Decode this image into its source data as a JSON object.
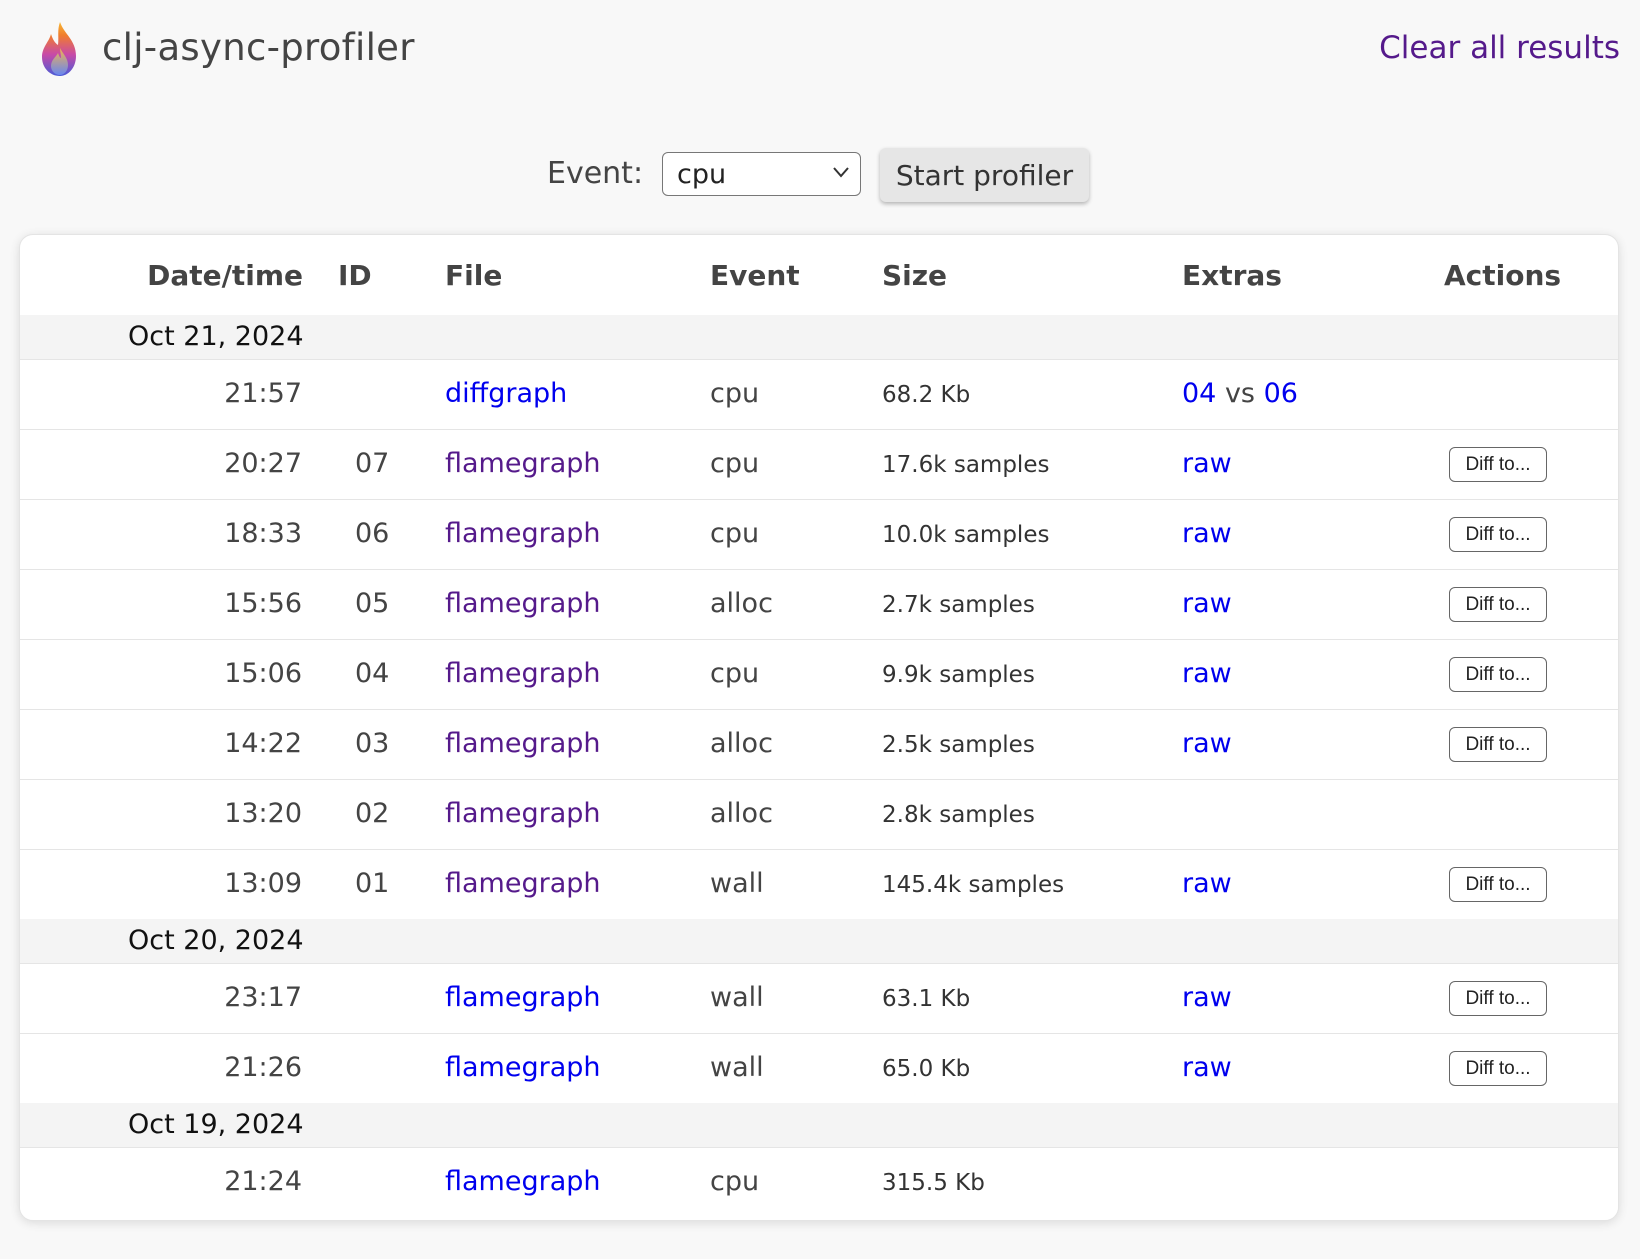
{
  "header": {
    "title": "clj-async-profiler",
    "clear_link": "Clear all results"
  },
  "controls": {
    "event_label": "Event:",
    "event_selected": "cpu",
    "start_button": "Start profiler"
  },
  "table": {
    "columns": [
      "Date/time",
      "ID",
      "File",
      "Event",
      "Size",
      "Extras",
      "Actions"
    ],
    "groups": [
      {
        "date": "Oct 21, 2024",
        "rows": [
          {
            "time": "21:57",
            "id": "",
            "file": "diffgraph",
            "event": "cpu",
            "size": "68.2 Kb",
            "extras_a": "04",
            "extras_vs": "vs",
            "extras_b": "06",
            "action": ""
          },
          {
            "time": "20:27",
            "id": "07",
            "file": "flamegraph",
            "event": "cpu",
            "size": "17.6k samples",
            "extras": "raw",
            "action": "Diff to..."
          },
          {
            "time": "18:33",
            "id": "06",
            "file": "flamegraph",
            "event": "cpu",
            "size": "10.0k samples",
            "extras": "raw",
            "action": "Diff to..."
          },
          {
            "time": "15:56",
            "id": "05",
            "file": "flamegraph",
            "event": "alloc",
            "size": "2.7k samples",
            "extras": "raw",
            "action": "Diff to..."
          },
          {
            "time": "15:06",
            "id": "04",
            "file": "flamegraph",
            "event": "cpu",
            "size": "9.9k samples",
            "extras": "raw",
            "action": "Diff to..."
          },
          {
            "time": "14:22",
            "id": "03",
            "file": "flamegraph",
            "event": "alloc",
            "size": "2.5k samples",
            "extras": "raw",
            "action": "Diff to..."
          },
          {
            "time": "13:20",
            "id": "02",
            "file": "flamegraph",
            "event": "alloc",
            "size": "2.8k samples",
            "extras": "",
            "action": ""
          },
          {
            "time": "13:09",
            "id": "01",
            "file": "flamegraph",
            "event": "wall",
            "size": "145.4k samples",
            "extras": "raw",
            "action": "Diff to..."
          }
        ]
      },
      {
        "date": "Oct 20, 2024",
        "rows": [
          {
            "time": "23:17",
            "id": "",
            "file": "flamegraph",
            "event": "wall",
            "size": "63.1 Kb",
            "extras": "raw",
            "action": "Diff to..."
          },
          {
            "time": "21:26",
            "id": "",
            "file": "flamegraph",
            "event": "wall",
            "size": "65.0 Kb",
            "extras": "raw",
            "action": "Diff to..."
          }
        ]
      },
      {
        "date": "Oct 19, 2024",
        "rows": [
          {
            "time": "21:24",
            "id": "",
            "file": "flamegraph",
            "event": "cpu",
            "size": "315.5 Kb",
            "extras": "",
            "action": ""
          }
        ]
      }
    ]
  },
  "colors": {
    "link": "#0000ee",
    "visited_link": "#551a8b",
    "date_row_bg": "#f4f4f4",
    "page_bg": "#f8f8f8"
  },
  "icons": {
    "logo": "flame-logo-icon",
    "select": "chevron-down-icon"
  }
}
